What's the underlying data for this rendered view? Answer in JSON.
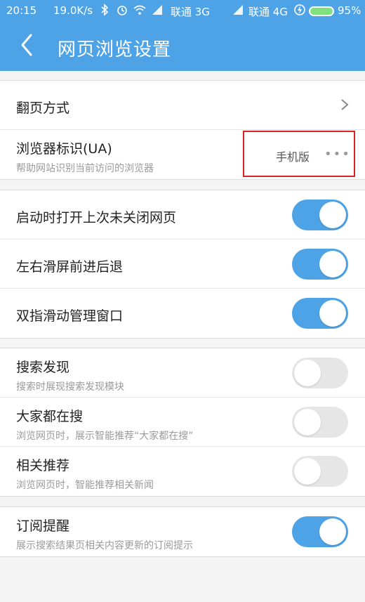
{
  "status_bar": {
    "time": "20:15",
    "speed": "19.0K/s",
    "carrier1": "联通 3G",
    "carrier2": "联通 4G",
    "battery": "95%"
  },
  "header": {
    "title": "网页浏览设置"
  },
  "sections": [
    {
      "items": [
        {
          "label": "翻页方式",
          "type": "link"
        },
        {
          "label": "浏览器标识(UA)",
          "sub": "帮助网站识别当前访问的浏览器",
          "value": "手机版",
          "type": "more"
        }
      ]
    },
    {
      "items": [
        {
          "label": "启动时打开上次未关闭网页",
          "type": "toggle",
          "on": true
        },
        {
          "label": "左右滑屏前进后退",
          "type": "toggle",
          "on": true
        },
        {
          "label": "双指滑动管理窗口",
          "type": "toggle",
          "on": true
        }
      ]
    },
    {
      "items": [
        {
          "label": "搜索发现",
          "sub": "搜索时展现搜索发现模块",
          "type": "toggle",
          "on": false
        },
        {
          "label": "大家都在搜",
          "sub": "浏览网页时，展示智能推荐“大家都在搜”",
          "type": "toggle",
          "on": false
        },
        {
          "label": "相关推荐",
          "sub": "浏览网页时，智能推荐相关新闻",
          "type": "toggle",
          "on": false
        }
      ]
    },
    {
      "items": [
        {
          "label": "订阅提醒",
          "sub": "展示搜索结果页相关内容更新的订阅提示",
          "type": "toggle",
          "on": true
        }
      ]
    }
  ],
  "colors": {
    "accent": "#4da3e6",
    "highlight": "#dd2222",
    "toggle_off": "#e6e6e6"
  },
  "icons": [
    "back-icon",
    "chevron-right-icon",
    "more-dots-icon",
    "wifi-icon",
    "alarm-icon",
    "bluetooth-icon",
    "battery-icon"
  ]
}
